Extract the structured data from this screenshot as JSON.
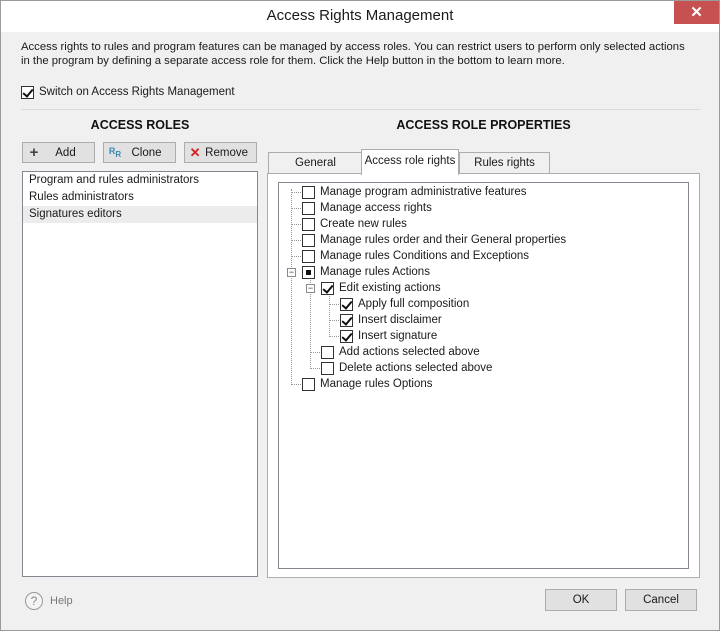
{
  "window": {
    "title": "Access Rights Management",
    "close_icon": "✕"
  },
  "intro": "Access rights to rules and program features can be managed by access roles. You can restrict users to perform only selected actions in the program by defining a separate access role for them. Click the Help button in the bottom to learn more.",
  "switch": {
    "label": "Switch on Access Rights Management",
    "checked": true
  },
  "roles": {
    "heading": "ACCESS ROLES",
    "buttons": {
      "add": "Add",
      "clone": "Clone",
      "remove": "Remove"
    },
    "items": [
      "Program and rules administrators",
      "Rules administrators",
      "Signatures editors"
    ],
    "selected_index": 2
  },
  "properties": {
    "heading": "ACCESS ROLE PROPERTIES",
    "tabs": [
      "General",
      "Access role rights",
      "Rules rights"
    ],
    "active_tab": 1,
    "tree": [
      {
        "label": "Manage program administrative features",
        "state": "unchecked"
      },
      {
        "label": "Manage access rights",
        "state": "unchecked"
      },
      {
        "label": "Create new rules",
        "state": "unchecked"
      },
      {
        "label": "Manage rules order and their General properties",
        "state": "unchecked"
      },
      {
        "label": "Manage rules Conditions and Exceptions",
        "state": "unchecked"
      },
      {
        "label": "Manage rules Actions",
        "state": "partial"
      },
      {
        "label": "Edit existing actions",
        "state": "checked"
      },
      {
        "label": "Apply full composition",
        "state": "checked"
      },
      {
        "label": "Insert disclaimer",
        "state": "checked"
      },
      {
        "label": "Insert signature",
        "state": "checked"
      },
      {
        "label": "Add actions selected above",
        "state": "unchecked"
      },
      {
        "label": "Delete actions selected above",
        "state": "unchecked"
      },
      {
        "label": "Manage rules Options",
        "state": "unchecked"
      }
    ]
  },
  "footer": {
    "help": "Help",
    "ok": "OK",
    "cancel": "Cancel"
  },
  "colors": {
    "close_button": "#c75050",
    "check": "#111111",
    "selected_row": "#ececec",
    "remove_icon": "#d42020",
    "clone_icon": "#3a8ab0"
  }
}
